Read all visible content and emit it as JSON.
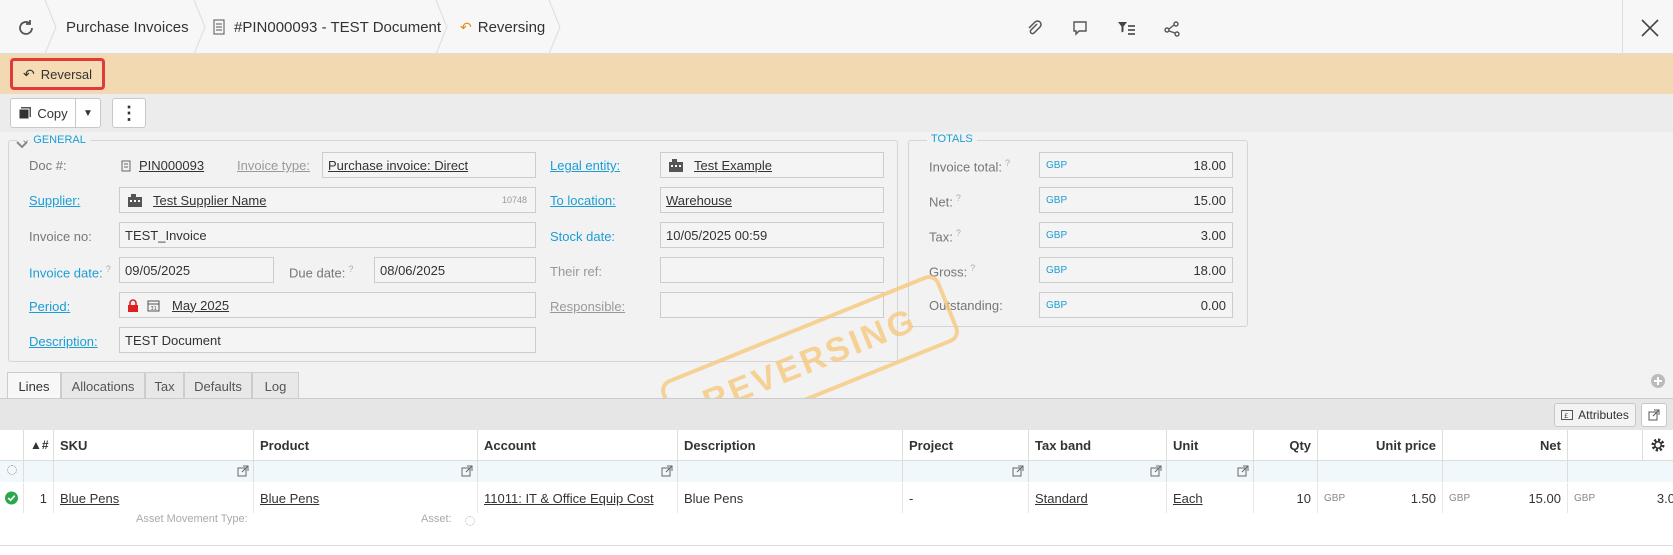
{
  "header": {
    "breadcrumbs": [
      "Purchase Invoices",
      "#PIN000093 - TEST Document",
      "Reversing"
    ],
    "icons": [
      "refresh-icon",
      "document-icon",
      "undo-icon",
      "paperclip-icon",
      "comment-icon",
      "filter-list-icon",
      "share-icon",
      "close-icon"
    ]
  },
  "banner": {
    "reversal_label": "Reversal"
  },
  "toolbar": {
    "copy_label": "Copy"
  },
  "general": {
    "legend": "GENERAL",
    "doc_label": "Doc #:",
    "doc_value": "PIN000093",
    "invoice_type_label": "Invoice type:",
    "invoice_type_value": "Purchase invoice: Direct",
    "legal_entity_label": "Legal entity:",
    "legal_entity_value": "Test Example",
    "supplier_label": "Supplier:",
    "supplier_value": "Test Supplier Name",
    "supplier_code": "10748",
    "to_location_label": "To location:",
    "to_location_value": "Warehouse",
    "invoice_no_label": "Invoice no:",
    "invoice_no_value": "TEST_Invoice",
    "stock_date_label": "Stock date:",
    "stock_date_value": "10/05/2025 00:59",
    "invoice_date_label": "Invoice date:",
    "invoice_date_value": "09/05/2025",
    "due_date_label": "Due date:",
    "due_date_value": "08/06/2025",
    "their_ref_label": "Their ref:",
    "their_ref_value": "",
    "period_label": "Period:",
    "period_value": "May 2025",
    "responsible_label": "Responsible:",
    "responsible_value": "",
    "description_label": "Description:",
    "description_value": "TEST Document"
  },
  "totals": {
    "legend": "TOTALS",
    "currency": "GBP",
    "rows": [
      {
        "label": "Invoice total:",
        "value": "18.00"
      },
      {
        "label": "Net:",
        "value": "15.00"
      },
      {
        "label": "Tax:",
        "value": "3.00"
      },
      {
        "label": "Gross:",
        "value": "18.00"
      },
      {
        "label": "Outstanding:",
        "value": "0.00"
      }
    ]
  },
  "watermark": "REVERSING",
  "tabs": [
    "Lines",
    "Allocations",
    "Tax",
    "Defaults",
    "Log"
  ],
  "grid": {
    "attributes_label": "Attributes",
    "columns": [
      "▲#",
      "SKU",
      "Product",
      "Account",
      "Description",
      "Project",
      "Tax band",
      "Unit",
      "Qty",
      "Unit price",
      "Net"
    ],
    "row": {
      "num": "1",
      "sku": "Blue Pens",
      "product": "Blue Pens",
      "account": "11011: IT & Office Equip Cost",
      "description": "Blue Pens",
      "project": "-",
      "tax_band": "Standard",
      "unit": "Each",
      "qty": "10",
      "unit_price_cur": "GBP",
      "unit_price": "1.50",
      "net_cur": "GBP",
      "net": "15.00",
      "gross_cur": "GBP",
      "gross": "3.0"
    },
    "sub_labels": {
      "asset_movement": "Asset Movement Type:",
      "asset": "Asset:"
    }
  },
  "colors": {
    "accent": "#1a9ed4",
    "banner": "#f3d9b1",
    "highlight": "#e03a3a",
    "stamp": "#f7c97e"
  }
}
